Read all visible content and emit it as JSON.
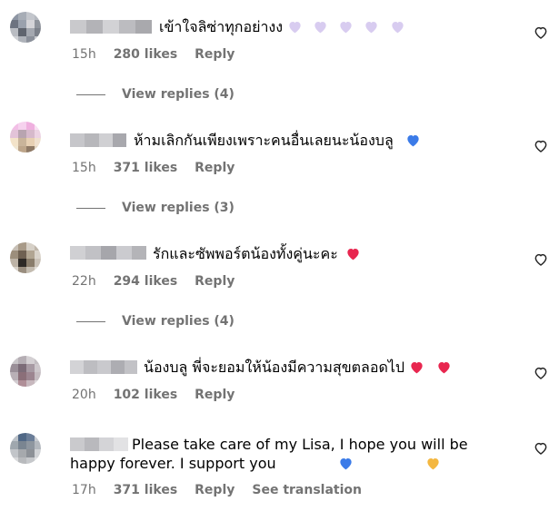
{
  "comments": [
    {
      "text": "เข้าใจลิซ่าทุกอย่างง",
      "emoji": [
        "purple-heart",
        "purple-heart",
        "purple-heart",
        "purple-heart",
        "purple-heart"
      ],
      "time": "15h",
      "likes": "280 likes",
      "reply": "Reply",
      "view_replies": "View replies (4)"
    },
    {
      "text": "ห้ามเลิกกันเพียงเพราะคนอื่นเลยนะน้องบลู",
      "emoji": [
        "blue-heart"
      ],
      "time": "15h",
      "likes": "371 likes",
      "reply": "Reply",
      "view_replies": "View replies (3)"
    },
    {
      "text": "รักและซัพพอร์ตน้องทั้งคู่นะคะ",
      "emoji": [
        "red-heart"
      ],
      "time": "22h",
      "likes": "294 likes",
      "reply": "Reply",
      "view_replies": "View replies (4)"
    },
    {
      "text": "น้องบลู พี่จะยอมให้น้องมีความสุขตลอดไป",
      "emoji": [
        "red-heart",
        "red-heart"
      ],
      "time": "20h",
      "likes": "102 likes",
      "reply": "Reply"
    },
    {
      "text": "Please take care of my Lisa, I hope you will be happy forever. I support you",
      "emoji": [
        "blue-heart",
        "yellow-heart"
      ],
      "time": "17h",
      "likes": "371 likes",
      "reply": "Reply",
      "translation": "See translation"
    }
  ],
  "colors": {
    "meta_gray": "#737373",
    "purple_heart": "#d8ccf0",
    "blue_heart": "#3b7be8",
    "red_heart": "#e8264f",
    "yellow_heart": "#f4b740"
  },
  "icons": {
    "like_button": "heart-outline-icon"
  }
}
